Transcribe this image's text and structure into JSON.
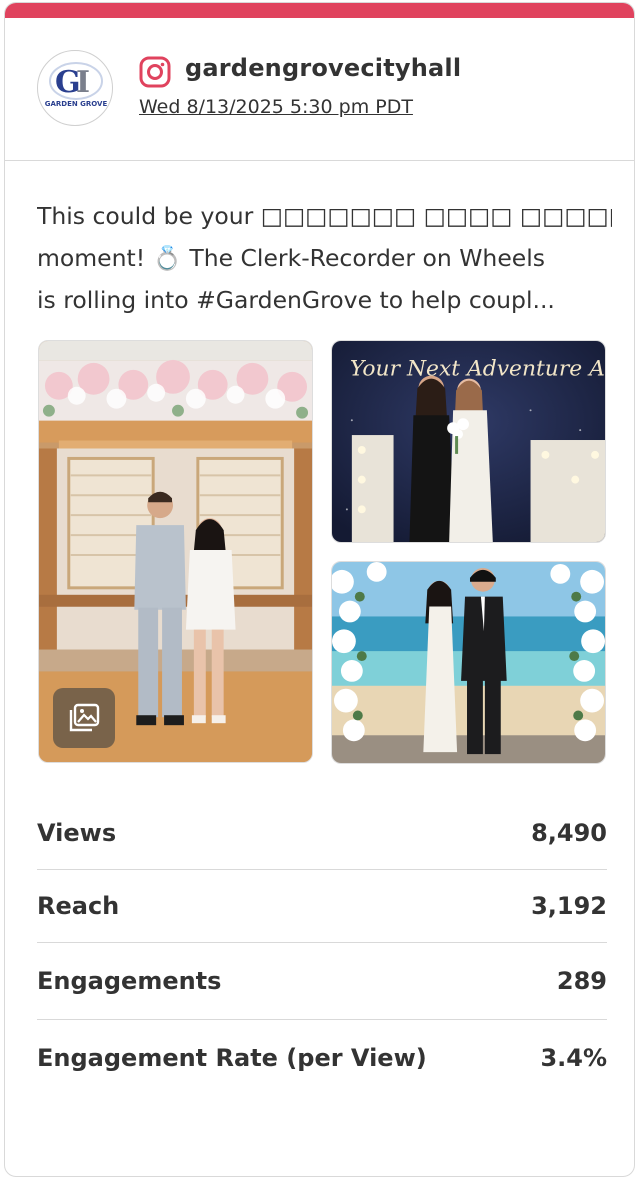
{
  "post": {
    "account": "gardengrovecityhall",
    "timestamp": "Wed 8/13/2025 5:30 pm PDT",
    "avatar_text": "GARDEN GROVE",
    "platform_icon": "instagram-icon",
    "caption_lines": [
      "This could be your □□□□□□□ □□□□ □□□□□",
      "moment! 💍 The Clerk-Recorder on Wheels",
      "is rolling into #GardenGrove to help coupl..."
    ],
    "photo2_text": "Your Next Adventure Awaits The Clerk-Re",
    "gallery_icon": "gallery-icon"
  },
  "stats": [
    {
      "label": "Views",
      "value": "8,490"
    },
    {
      "label": "Reach",
      "value": "3,192"
    },
    {
      "label": "Engagements",
      "value": "289"
    },
    {
      "label": "Engagement Rate (per View)",
      "value": "3.4%"
    }
  ],
  "colors": {
    "accent": "#e0435e",
    "text": "#333333",
    "divider": "#d9d9d9"
  }
}
